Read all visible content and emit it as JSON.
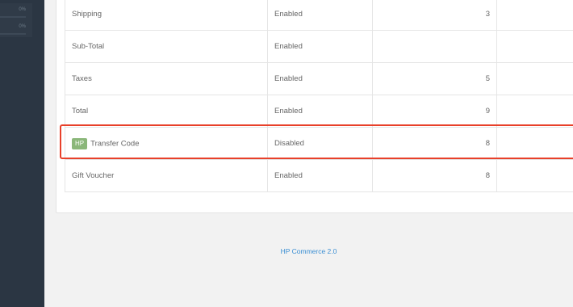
{
  "sidebar": {
    "progress": [
      {
        "label": "0%",
        "value": 0.0
      },
      {
        "label": "0%",
        "value": 0.0
      }
    ]
  },
  "extensions": {
    "rows": [
      {
        "name": "Shipping",
        "status": "Enabled",
        "sort_order": "3",
        "badge": ""
      },
      {
        "name": "Sub-Total",
        "status": "Enabled",
        "sort_order": "",
        "badge": ""
      },
      {
        "name": "Taxes",
        "status": "Enabled",
        "sort_order": "5",
        "badge": ""
      },
      {
        "name": "Total",
        "status": "Enabled",
        "sort_order": "9",
        "badge": ""
      },
      {
        "name": "Transfer Code",
        "status": "Disabled",
        "sort_order": "8",
        "badge": "HP"
      },
      {
        "name": "Gift Voucher",
        "status": "Enabled",
        "sort_order": "8",
        "badge": ""
      }
    ]
  },
  "footer": {
    "text": "HP Commerce 2.0"
  },
  "colors": {
    "sidebar_bg": "#2b3643",
    "highlight": "#e8402a",
    "badge_bg": "#8bb77a",
    "link": "#3b8fd3"
  }
}
